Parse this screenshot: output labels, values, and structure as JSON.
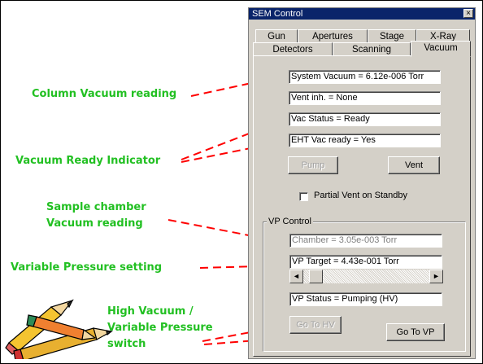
{
  "annotations": {
    "column_vacuum": "Column Vacuum reading",
    "vacuum_ready": "Vacuum Ready Indicator",
    "sample_chamber_1": "Sample chamber",
    "sample_chamber_2": "Vacuum reading",
    "variable_pressure": "Variable Pressure setting",
    "hv_vp_1": "High Vacuum /",
    "hv_vp_2": "Variable Pressure",
    "hv_vp_3": "switch"
  },
  "window": {
    "title": "SEM Control",
    "close_symbol": "×"
  },
  "tabs": {
    "row1": [
      "Gun",
      "Apertures",
      "Stage",
      "X-Ray"
    ],
    "row2": [
      "Detectors",
      "Scanning",
      "Vacuum"
    ],
    "active": "Vacuum"
  },
  "vacuum": {
    "system_vacuum": "System Vacuum = 6.12e-006 Torr",
    "vent_inh": "Vent inh. = None",
    "vac_status": "Vac Status = Ready",
    "eht_vac_ready": "EHT Vac ready = Yes",
    "pump_label": "Pump",
    "vent_label": "Vent",
    "partial_vent_label": "Partial Vent on Standby",
    "partial_vent_checked": false
  },
  "vp_control": {
    "group_label": "VP Control",
    "chamber": "Chamber = 3.05e-003 Torr",
    "vp_target": "VP Target = 4.43e-001 Torr",
    "vp_status": "VP Status = Pumping (HV)",
    "go_to_hv_label": "Go To HV",
    "go_to_vp_label": "Go To VP",
    "scroll_left_symbol": "◄",
    "scroll_right_symbol": "►"
  },
  "colors": {
    "annotation_text": "#22c022",
    "arrow": "#ff0000",
    "titlebar": "#0a246a",
    "window_bg": "#d4d0c8"
  }
}
